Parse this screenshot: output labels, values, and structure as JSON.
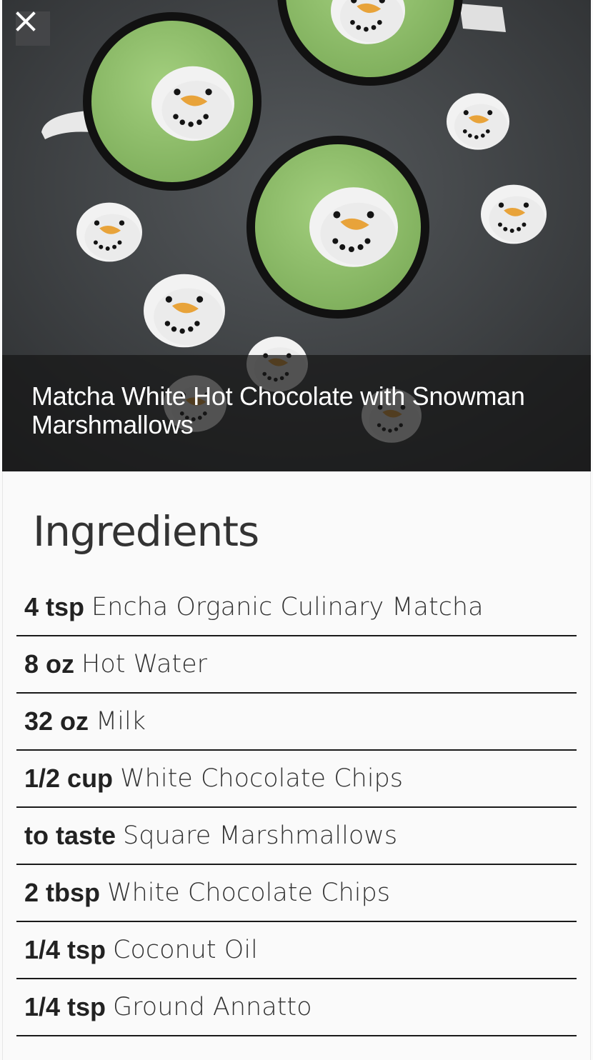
{
  "recipe": {
    "title": "Matcha White Hot Chocolate with Snowman Marshmallows"
  },
  "close_icon": "close-icon",
  "ingredients": {
    "heading": "Ingredients",
    "items": [
      {
        "qty": "4 tsp",
        "name": "Encha Organic Culinary Matcha"
      },
      {
        "qty": "8 oz",
        "name": "Hot Water"
      },
      {
        "qty": "32 oz",
        "name": "Milk"
      },
      {
        "qty": "1/2 cup",
        "name": "White Chocolate Chips"
      },
      {
        "qty": "to taste",
        "name": "Square Marshmallows"
      },
      {
        "qty": "2 tbsp",
        "name": "White Chocolate Chips"
      },
      {
        "qty": "1/4 tsp",
        "name": "Coconut Oil"
      },
      {
        "qty": "1/4 tsp",
        "name": "Ground Annatto"
      }
    ]
  },
  "colors": {
    "matcha_green": "#8fbf6a",
    "mug_black": "#151515",
    "slate_background": "#3d4043",
    "marshmallow_white": "#f2f2f2",
    "carrot_nose": "#e8a33a"
  }
}
